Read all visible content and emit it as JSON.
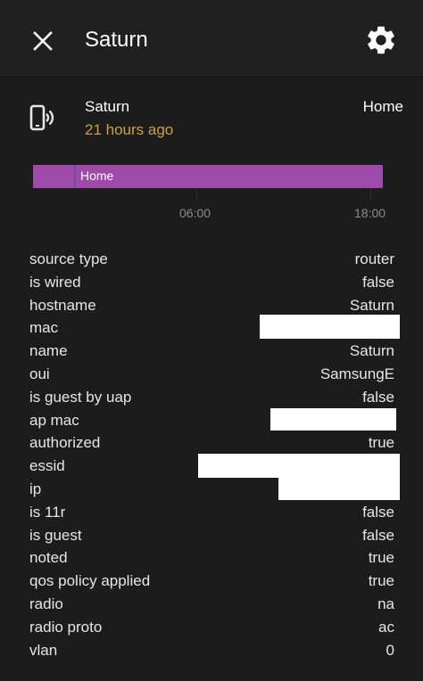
{
  "header": {
    "title": "Saturn"
  },
  "entity": {
    "name": "Saturn",
    "last_changed": "21 hours ago",
    "state": "Home"
  },
  "timeline": {
    "bar_label": "Home",
    "ticks": [
      "06:00",
      "18:00"
    ]
  },
  "attributes": [
    {
      "key": "source type",
      "value": "router"
    },
    {
      "key": "is wired",
      "value": "false"
    },
    {
      "key": "hostname",
      "value": "Saturn"
    },
    {
      "key": "mac",
      "value": ""
    },
    {
      "key": "name",
      "value": "Saturn"
    },
    {
      "key": "oui",
      "value": "SamsungE"
    },
    {
      "key": "is guest by uap",
      "value": "false"
    },
    {
      "key": "ap mac",
      "value": ""
    },
    {
      "key": "authorized",
      "value": "true"
    },
    {
      "key": "essid",
      "value": ""
    },
    {
      "key": "ip",
      "value": ""
    },
    {
      "key": "is 11r",
      "value": "false"
    },
    {
      "key": "is guest",
      "value": "false"
    },
    {
      "key": "noted",
      "value": "true"
    },
    {
      "key": "qos policy applied",
      "value": "true"
    },
    {
      "key": "radio",
      "value": "na"
    },
    {
      "key": "radio proto",
      "value": "ac"
    },
    {
      "key": "vlan",
      "value": "0"
    }
  ],
  "colors": {
    "background": "#1c1c1c",
    "header": "#202020",
    "accent_time": "#c8a14b",
    "timeline_bar": "#9d4aa8"
  },
  "icons": {
    "close": "close-icon",
    "settings": "gear-icon",
    "entity": "cellphone-wireless-icon"
  }
}
